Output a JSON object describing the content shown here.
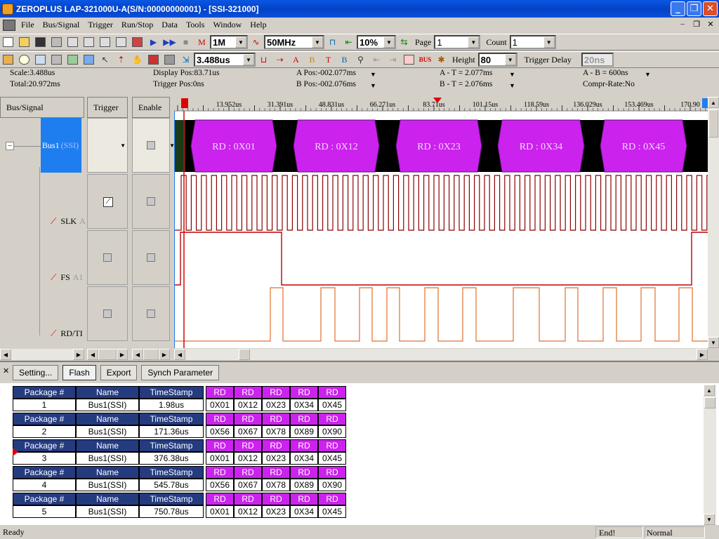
{
  "window": {
    "title": "ZEROPLUS LAP-321000U-A(S/N:00000000001) - [SSI-321000]"
  },
  "menu": [
    "File",
    "Bus/Signal",
    "Trigger",
    "Run/Stop",
    "Data",
    "Tools",
    "Window",
    "Help"
  ],
  "toolbar1": {
    "memory": "1M",
    "frequency": "50MHz",
    "zoom": "10%",
    "page_label": "Page",
    "page_value": "1",
    "count_label": "Count",
    "count_value": "1"
  },
  "toolbar2": {
    "time_value": "3.488us",
    "height_label": "Height",
    "height_value": "80",
    "trigger_delay_label": "Trigger Delay",
    "trigger_delay_value": "20ns"
  },
  "info": {
    "scale": "Scale:3.488us",
    "total": "Total:20.972ms",
    "display_pos": "Display Pos:83.71us",
    "trigger_pos": "Trigger Pos:0ns",
    "a_pos": "A Pos:-002.077ms",
    "b_pos": "B Pos:-002.076ms",
    "a_t": "A - T = 2.077ms",
    "b_t": "B - T = 2.076ms",
    "a_b": "A - B = 600ns",
    "compr": "Compr-Rate:No"
  },
  "columns": {
    "bus_signal": "Bus/Signal",
    "trigger": "Trigger",
    "enable": "Enable"
  },
  "signals": [
    {
      "name": "Bus1",
      "suffix": "(SSI)"
    },
    {
      "name": "SLK",
      "suffix": "A"
    },
    {
      "name": "FS",
      "suffix": "A1"
    },
    {
      "name": "RD/TI",
      "suffix": ""
    }
  ],
  "timeline": [
    "13.952us",
    "31.391us",
    "48.831us",
    "66.271us",
    "83.71us",
    "101.15us",
    "118.59us",
    "136.029us",
    "153.469us",
    "170.90"
  ],
  "bus_segments": [
    "RD : 0X01",
    "RD : 0X12",
    "RD : 0X23",
    "RD : 0X34",
    "RD : 0X45"
  ],
  "panel_buttons": [
    "Setting...",
    "Flash",
    "Export",
    "Synch Parameter"
  ],
  "packet_headers": {
    "package": "Package #",
    "name": "Name",
    "timestamp": "TimeStamp",
    "rd": "RD"
  },
  "packets": [
    {
      "num": "1",
      "name": "Bus1(SSI)",
      "ts": "1.98us",
      "rd": [
        "0X01",
        "0X12",
        "0X23",
        "0X34",
        "0X45"
      ]
    },
    {
      "num": "2",
      "name": "Bus1(SSI)",
      "ts": "171.36us",
      "rd": [
        "0X56",
        "0X67",
        "0X78",
        "0X89",
        "0X90"
      ]
    },
    {
      "num": "3",
      "name": "Bus1(SSI)",
      "ts": "376.38us",
      "rd": [
        "0X01",
        "0X12",
        "0X23",
        "0X34",
        "0X45"
      ]
    },
    {
      "num": "4",
      "name": "Bus1(SSI)",
      "ts": "545.78us",
      "rd": [
        "0X56",
        "0X67",
        "0X78",
        "0X89",
        "0X90"
      ]
    },
    {
      "num": "5",
      "name": "Bus1(SSI)",
      "ts": "750.78us",
      "rd": [
        "0X01",
        "0X12",
        "0X23",
        "0X34",
        "0X45"
      ]
    }
  ],
  "status": {
    "left": "Ready",
    "mid": "End!",
    "right": "Normal"
  },
  "colors": {
    "bus": "#cc22ee",
    "slk": "#8b0000",
    "fs": "#c00000",
    "rd": "#e07030",
    "header": "#253b80"
  }
}
